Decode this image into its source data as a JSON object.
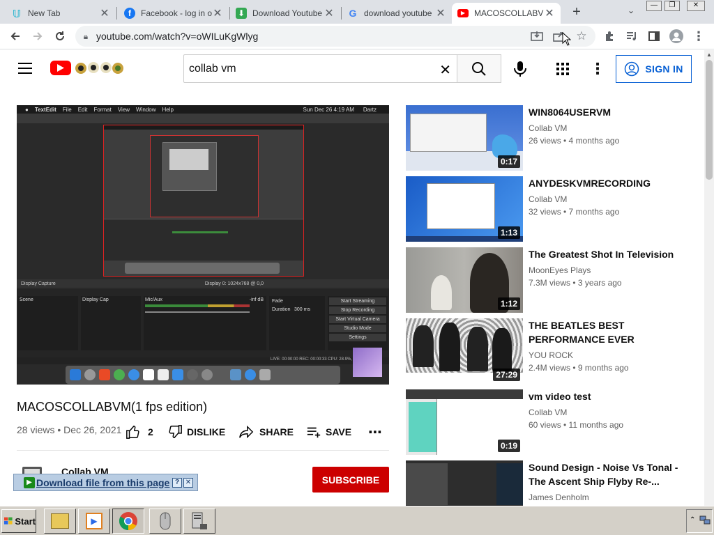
{
  "browser": {
    "tabs": [
      {
        "title": "New Tab",
        "favicon": "#29b6d0"
      },
      {
        "title": "Facebook - log in or",
        "favicon": "#1877f2"
      },
      {
        "title": "Download Youtube",
        "favicon": "#34a853"
      },
      {
        "title": "download youtube",
        "favicon": "google"
      },
      {
        "title": "MACOSCOLLABVM(",
        "favicon": "#ff0000"
      }
    ],
    "url": "youtube.com/watch?v=oWILuKgWlyg"
  },
  "yt": {
    "search_value": "collab vm",
    "signin_label": "SIGN IN"
  },
  "video": {
    "title": "MACOSCOLLABVM(1 fps edition)",
    "meta": "28 views • Dec 26, 2021",
    "likes": "2",
    "dislike_label": "DISLIKE",
    "share_label": "SHARE",
    "save_label": "SAVE",
    "channel": "Collab VM",
    "subscribe_label": "SUBSCRIBE"
  },
  "download_bar": {
    "label": "Download file from this page"
  },
  "recommendations": [
    {
      "title": "WIN8064USERVM",
      "channel": "Collab VM",
      "meta": "26 views • 4 months ago",
      "duration": "0:17"
    },
    {
      "title": "ANYDESKVMRECORDING",
      "channel": "Collab VM",
      "meta": "32 views • 7 months ago",
      "duration": "1:13"
    },
    {
      "title": "The Greatest Shot In Television",
      "channel": "MoonEyes Plays",
      "meta": "7.3M views • 3 years ago",
      "duration": "1:12"
    },
    {
      "title": "THE BEATLES BEST PERFORMANCE EVER",
      "channel": "YOU ROCK",
      "meta": "2.4M views • 9 months ago",
      "duration": "27:29"
    },
    {
      "title": "vm video test",
      "channel": "Collab VM",
      "meta": "60 views • 11 months ago",
      "duration": "0:19"
    },
    {
      "title": "Sound Design - Noise Vs Tonal - The Ascent Ship Flyby Re-...",
      "channel": "James Denholm",
      "meta": "",
      "duration": ""
    }
  ],
  "taskbar": {
    "start_label": "Start"
  },
  "player_screen": {
    "menubar": [
      "TextEdit",
      "File",
      "Edit",
      "Format",
      "View",
      "Window",
      "Help"
    ],
    "clock": "Sun Dec 26  4:19 AM",
    "user": "Dartz",
    "obs_controls": [
      "Start Streaming",
      "Stop Recording",
      "Start Virtual Camera",
      "Studio Mode",
      "Settings"
    ],
    "source_row": "Display Capture",
    "res_label": "Display 0: 1024x768 @ 0,0",
    "mixer": "Mic/Aux",
    "db": "-inf dB",
    "fade": "Fade",
    "duration_label": "Duration",
    "duration_val": "300 ms",
    "scene": "Scene",
    "display_cap": "Display Cap",
    "status": "LIVE: 00:00:00   REC: 00:00:33   CPU: 28.9%, 1.20 fps"
  }
}
